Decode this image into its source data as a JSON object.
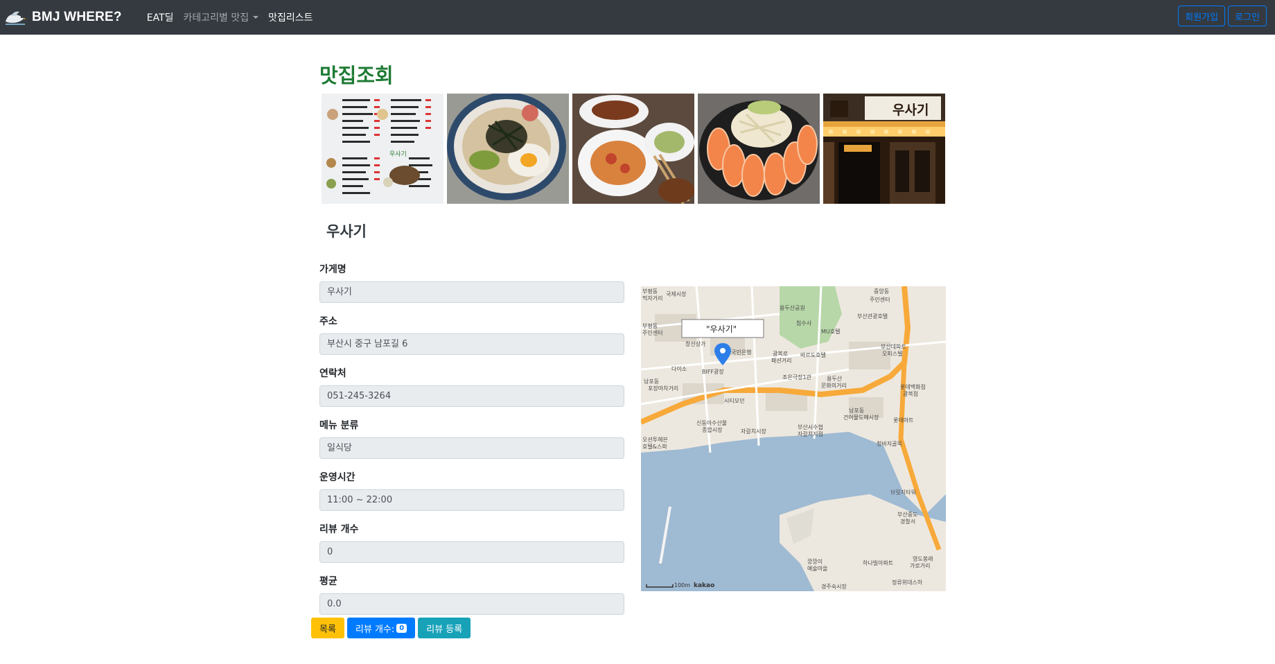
{
  "navbar": {
    "brand": "BMJ WHERE?",
    "links": [
      "EAT딜",
      "카테고리별 맛집",
      "맛집리스트"
    ],
    "signup": "회원가입",
    "login": "로그인"
  },
  "page": {
    "title": "맛집조회",
    "store_name": "우사기"
  },
  "photos": [
    {
      "name": "menu-board-photo"
    },
    {
      "name": "rice-bowl-photo"
    },
    {
      "name": "fried-chicken-plate-photo"
    },
    {
      "name": "salmon-sashimi-photo"
    },
    {
      "name": "storefront-photo"
    }
  ],
  "fields": [
    {
      "label": "가게명",
      "value": "우사기"
    },
    {
      "label": "주소",
      "value": "부산시 중구 남포길 6"
    },
    {
      "label": "연락처",
      "value": "051-245-3264"
    },
    {
      "label": "메뉴 분류",
      "value": "일식당"
    },
    {
      "label": "운영시간",
      "value": "11:00 ~ 22:00"
    },
    {
      "label": "리뷰 개수",
      "value": "0"
    },
    {
      "label": "평균",
      "value": "0.0"
    }
  ],
  "map": {
    "marker_label": "\"우사기\"",
    "scale": "100m",
    "provider": "kakao",
    "places": [
      "부평동 먹자거리",
      "국제시장",
      "부평동 주민센터",
      "중앙동 주민센터",
      "부산관광호텔",
      "용두산공원",
      "창선상가",
      "국민은행",
      "다이소",
      "BIFF광장",
      "광복로 패션거리",
      "바르도호텔",
      "부산데파트 오피스텔",
      "남포동 포장마차거리",
      "시티모던",
      "조은극장1관",
      "용두산 문화의거리",
      "롯데백화점 광복점",
      "신동아수산물 종합시장",
      "자갈치시장",
      "부산시수협 자갈치지점",
      "남포동 건어물도매시장",
      "롯데마트",
      "오션투헤븐 호텔&스파",
      "청바지골목",
      "부산데파트",
      "브릿지타워",
      "부산중도 경찰서",
      "깡깡이 예술마을",
      "하나빌아파트",
      "영도봉래 가로거리",
      "정류위대스하",
      "경주숙시장",
      "침수사",
      "MU호텔"
    ],
    "colors": {
      "water": "#9fbad3",
      "land": "#ede8df",
      "park": "#b7d7a8",
      "road": "#f7a93a"
    }
  },
  "buttons": {
    "list": "목록",
    "review_count_label": "리뷰 개수:",
    "review_count": "0",
    "review_register": "리뷰 등록"
  }
}
